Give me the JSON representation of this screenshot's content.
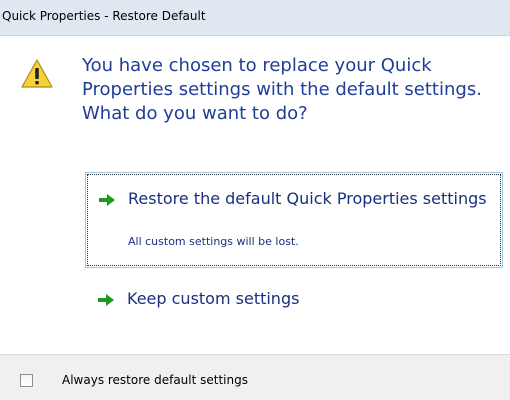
{
  "window": {
    "title": "Quick Properties - Restore Default"
  },
  "dialog": {
    "icon": "warning-icon",
    "instruction": "You have chosen to replace your Quick Properties settings with the default settings. What do you want to do?",
    "options": [
      {
        "label": "Restore the default Quick Properties settings",
        "note": "All custom settings will be lost.",
        "icon": "green-arrow-icon",
        "focused": true
      },
      {
        "label": "Keep custom settings",
        "icon": "green-arrow-icon",
        "focused": false
      }
    ]
  },
  "footer": {
    "checkbox_label": "Always restore default settings",
    "checked": false
  },
  "colors": {
    "title_bar": "#dfe8f1",
    "instruction_text": "#1f3d99",
    "link_text": "#1a2f80",
    "arrow": "#1f9a1f",
    "footer_bg": "#f0f0f0"
  }
}
